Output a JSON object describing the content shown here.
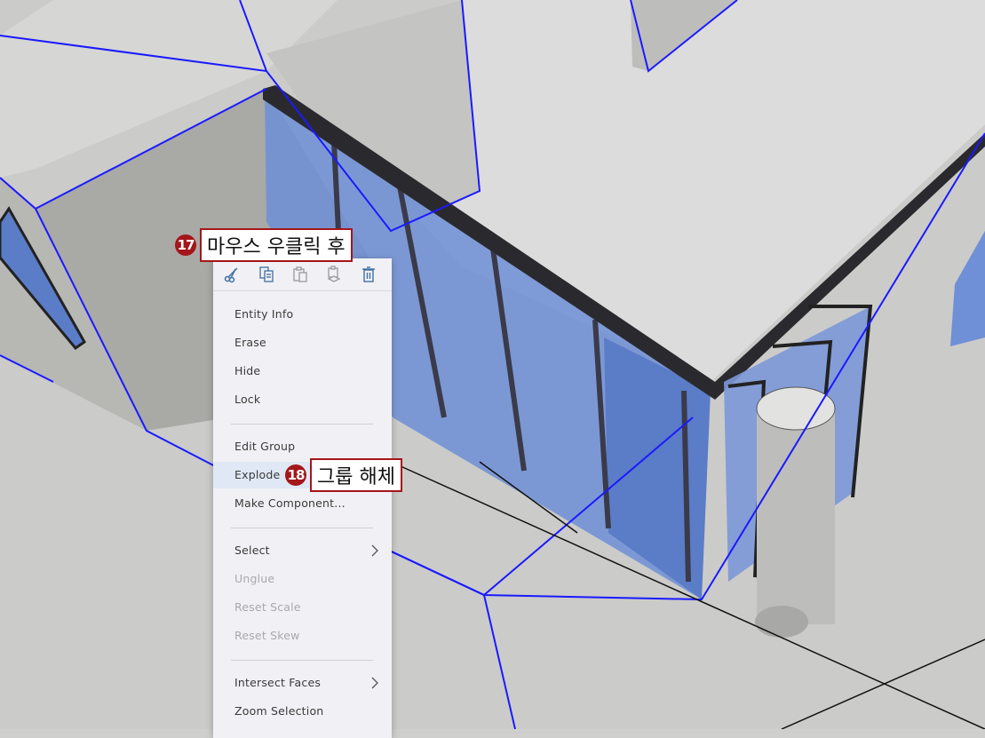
{
  "toolbar": {
    "icons": [
      "scissors-icon",
      "copy-icon",
      "paste-icon",
      "paste-in-place-icon",
      "trash-icon"
    ]
  },
  "menu": {
    "entity_info": "Entity Info",
    "erase": "Erase",
    "hide": "Hide",
    "lock": "Lock",
    "edit_group": "Edit Group",
    "explode": "Explode",
    "make_component": "Make Component...",
    "select": "Select",
    "unglue": "Unglue",
    "reset_scale": "Reset Scale",
    "reset_skew": "Reset Skew",
    "intersect_faces": "Intersect Faces",
    "zoom_selection": "Zoom Selection"
  },
  "annotations": {
    "step17_number": "17",
    "step17_text": "마우스 우클릭 후",
    "step18_number": "18",
    "step18_text": "그룹 해체"
  },
  "colors": {
    "selection_blue": "#1a1aff",
    "glass": "#6f8fd6",
    "callout_red": "#a4161a",
    "menu_bg": "#f1f1f5"
  }
}
